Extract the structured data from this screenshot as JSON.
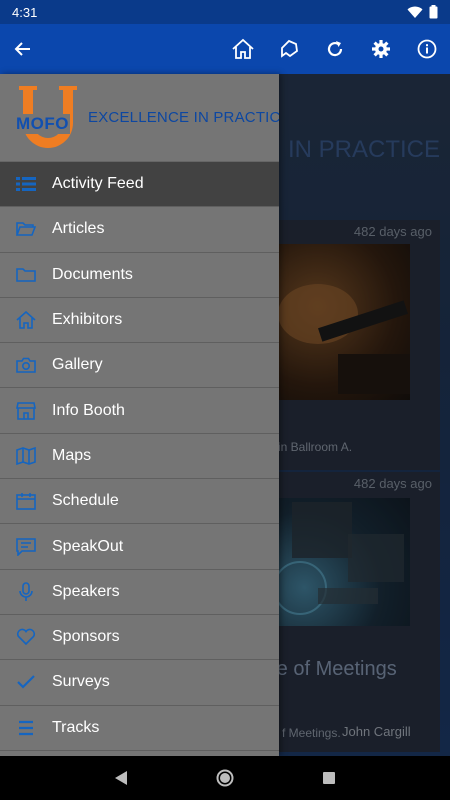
{
  "status_bar": {
    "time": "4:31"
  },
  "app_bar": {
    "icons": [
      "back-arrow-icon",
      "home-icon",
      "bookmark-icon",
      "refresh-icon",
      "settings-icon",
      "info-icon"
    ]
  },
  "logo": {
    "mark_text": "MOFO",
    "tagline": "EXCELLENCE IN PRACTICE"
  },
  "background": {
    "banner_text": "IN PRACTICE",
    "cards": [
      {
        "ago": "482 days ago",
        "caption": "in Ballroom A."
      },
      {
        "ago": "482 days ago",
        "title": "re of Meetings",
        "caption": "f Meetings.",
        "author": "John Cargill"
      }
    ]
  },
  "drawer": {
    "items": [
      {
        "label": "Activity Feed",
        "icon": "activity-feed-icon",
        "active": true
      },
      {
        "label": "Articles",
        "icon": "folder-open-icon"
      },
      {
        "label": "Documents",
        "icon": "folder-icon"
      },
      {
        "label": "Exhibitors",
        "icon": "home-icon"
      },
      {
        "label": "Gallery",
        "icon": "camera-icon"
      },
      {
        "label": "Info Booth",
        "icon": "storefront-icon"
      },
      {
        "label": "Maps",
        "icon": "map-icon"
      },
      {
        "label": "Schedule",
        "icon": "calendar-icon"
      },
      {
        "label": "SpeakOut",
        "icon": "chat-icon"
      },
      {
        "label": "Speakers",
        "icon": "microphone-icon"
      },
      {
        "label": "Sponsors",
        "icon": "heart-icon"
      },
      {
        "label": "Surveys",
        "icon": "check-icon"
      },
      {
        "label": "Tracks",
        "icon": "list-icon"
      }
    ]
  },
  "colors": {
    "app_bar": "#0b47ad",
    "status_bar": "#0a3a8a",
    "drawer_bg": "#757575",
    "drawer_active": "#424242",
    "icon_blue": "#1565c0",
    "logo_orange": "#ef7d22"
  }
}
